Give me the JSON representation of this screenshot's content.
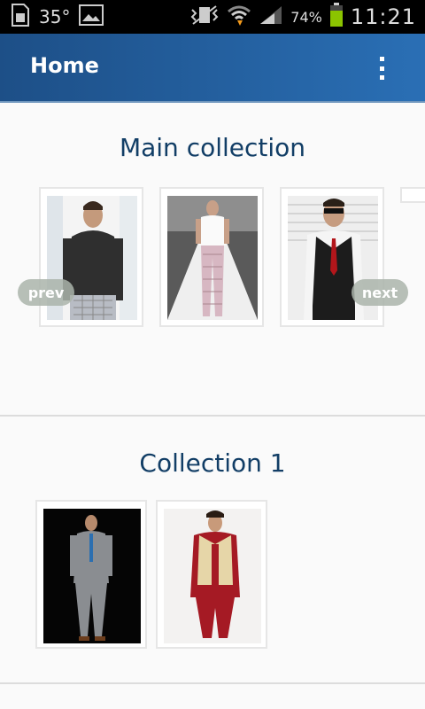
{
  "status_bar": {
    "temperature": "35°",
    "battery_percent": "74%",
    "time": "11:21"
  },
  "app_bar": {
    "title": "Home",
    "overflow_icon": "overflow-menu-icon"
  },
  "sections": [
    {
      "title": "Main collection",
      "prev_label": "prev",
      "next_label": "next",
      "items": [
        "photo-man-dark-henley",
        "photo-runway-model",
        "photo-man-vest-sunglasses"
      ]
    },
    {
      "title": "Collection 1",
      "items": [
        "photo-man-grey-suit",
        "photo-man-sherwani"
      ]
    }
  ],
  "colors": {
    "app_bar_start": "#1d4f87",
    "app_bar_end": "#2a6fb5",
    "section_title": "#123e66"
  }
}
